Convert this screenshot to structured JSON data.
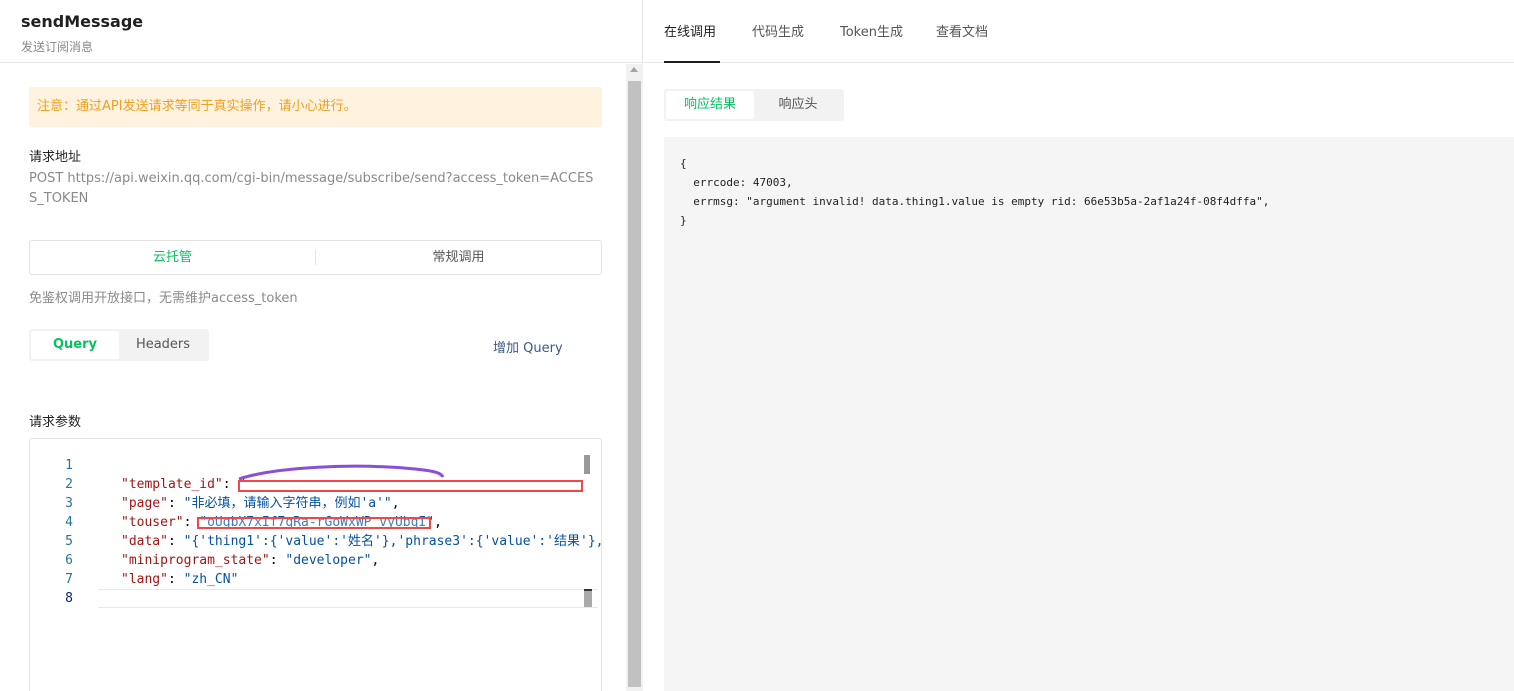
{
  "left": {
    "api_name": "sendMessage",
    "api_desc": "发送订阅消息",
    "warning": "注意：通过API发送请求等同于真实操作，请小心进行。",
    "request_url_title": "请求地址",
    "request_url": "POST https://api.weixin.qq.com/cgi-bin/message/subscribe/send?access_token=ACCESS_TOKEN",
    "mode": {
      "options": [
        "云托管",
        "常规调用"
      ],
      "selected": "云托管"
    },
    "hint": "免鉴权调用开放接口，无需维护access_token",
    "param_tabs": [
      "Query",
      "Headers"
    ],
    "add_query": "增加 Query",
    "params_title": "请求参数",
    "editor": {
      "line_numbers": [
        "1",
        "2",
        "3",
        "4",
        "5",
        "6",
        "7",
        "8"
      ],
      "lines": [
        {
          "key": "",
          "value": "",
          "trail": ""
        },
        {
          "key": "\"template_id\"",
          "value": "\"",
          "trail": ","
        },
        {
          "key": "\"page\"",
          "value": "\"非必填，请输入字符串，例如'a'\"",
          "trail": ","
        },
        {
          "key": "\"touser\"",
          "value": "\"oUgbX7xIf7qRa-rGoWxWP_vyUbqI\"",
          "trail": ","
        },
        {
          "key": "\"data\"",
          "value": "\"{'thing1':{'value':'姓名'},'phrase3':{'value':'结果'},",
          "trail": ""
        },
        {
          "key": "\"miniprogram_state\"",
          "value": "\"developer\"",
          "trail": ","
        },
        {
          "key": "\"lang\"",
          "value": "\"zh_CN\"",
          "trail": ""
        },
        {
          "key": "",
          "value": "",
          "trail": ""
        }
      ]
    }
  },
  "right": {
    "top_tabs": [
      "在线调用",
      "代码生成",
      "Token生成",
      "查看文档"
    ],
    "active_top_tab": "在线调用",
    "result_tabs": [
      "响应结果",
      "响应头"
    ],
    "active_result_tab": "响应结果",
    "response": "{\n  errcode: 47003,\n  errmsg: \"argument invalid! data.thing1.value is empty rid: 66e53b5a-2af1a24f-08f4dffa\",\n}"
  },
  "colors": {
    "accent": "#07c160",
    "warning_bg": "#fff3e0",
    "warning_text": "#f0a020",
    "redaction": "#f04848"
  }
}
